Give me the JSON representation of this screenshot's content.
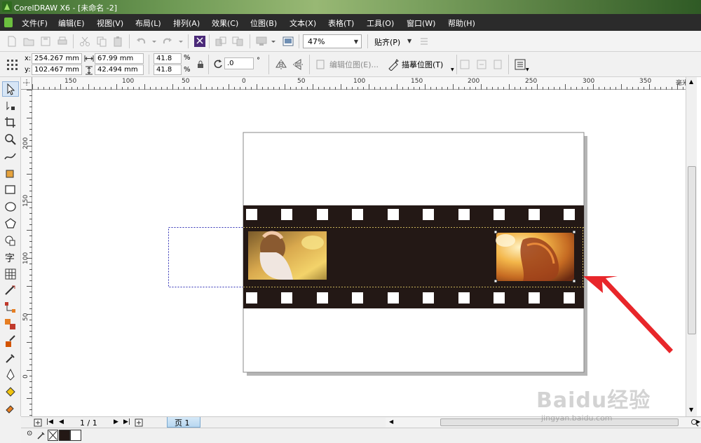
{
  "window": {
    "title": "CorelDRAW X6 - [未命名 -2]"
  },
  "menu": {
    "items": [
      "文件(F)",
      "编辑(E)",
      "视图(V)",
      "布局(L)",
      "排列(A)",
      "效果(C)",
      "位图(B)",
      "文本(X)",
      "表格(T)",
      "工具(O)",
      "窗口(W)",
      "帮助(H)"
    ]
  },
  "standard_toolbar": {
    "zoom_value": "47%",
    "snap_label": "贴齐(P)"
  },
  "property_bar": {
    "x_label": "x:",
    "x_value": "254.267 mm",
    "y_label": "y:",
    "y_value": "102.467 mm",
    "width_value": "67.99 mm",
    "height_value": "42.494 mm",
    "scale_x": "41.8",
    "scale_y": "41.8",
    "percent_x": "%",
    "percent_y": "%",
    "rotation_value": ".0",
    "rotation_unit": "°",
    "edit_bitmap_label": "编辑位图(E)...",
    "trace_bitmap_label": "描摹位图(T)"
  },
  "ruler": {
    "unit_label": "毫米",
    "h_ticks": [
      "150",
      "100",
      "50",
      "0",
      "50",
      "100",
      "150",
      "200",
      "250",
      "300",
      "350"
    ],
    "v_ticks": [
      "200",
      "150",
      "100",
      "50",
      "0"
    ]
  },
  "pagebar": {
    "page_count": "1 / 1",
    "page_tab": "页 1"
  },
  "watermark": {
    "brand": "Baidu经验",
    "url": "jingyan.baidu.com"
  },
  "colors": {
    "menubar": "#2b2b2b",
    "film_strip": "#231815",
    "annotation_arrow": "#e8262a",
    "selection_dash": "#2f2fb4"
  }
}
